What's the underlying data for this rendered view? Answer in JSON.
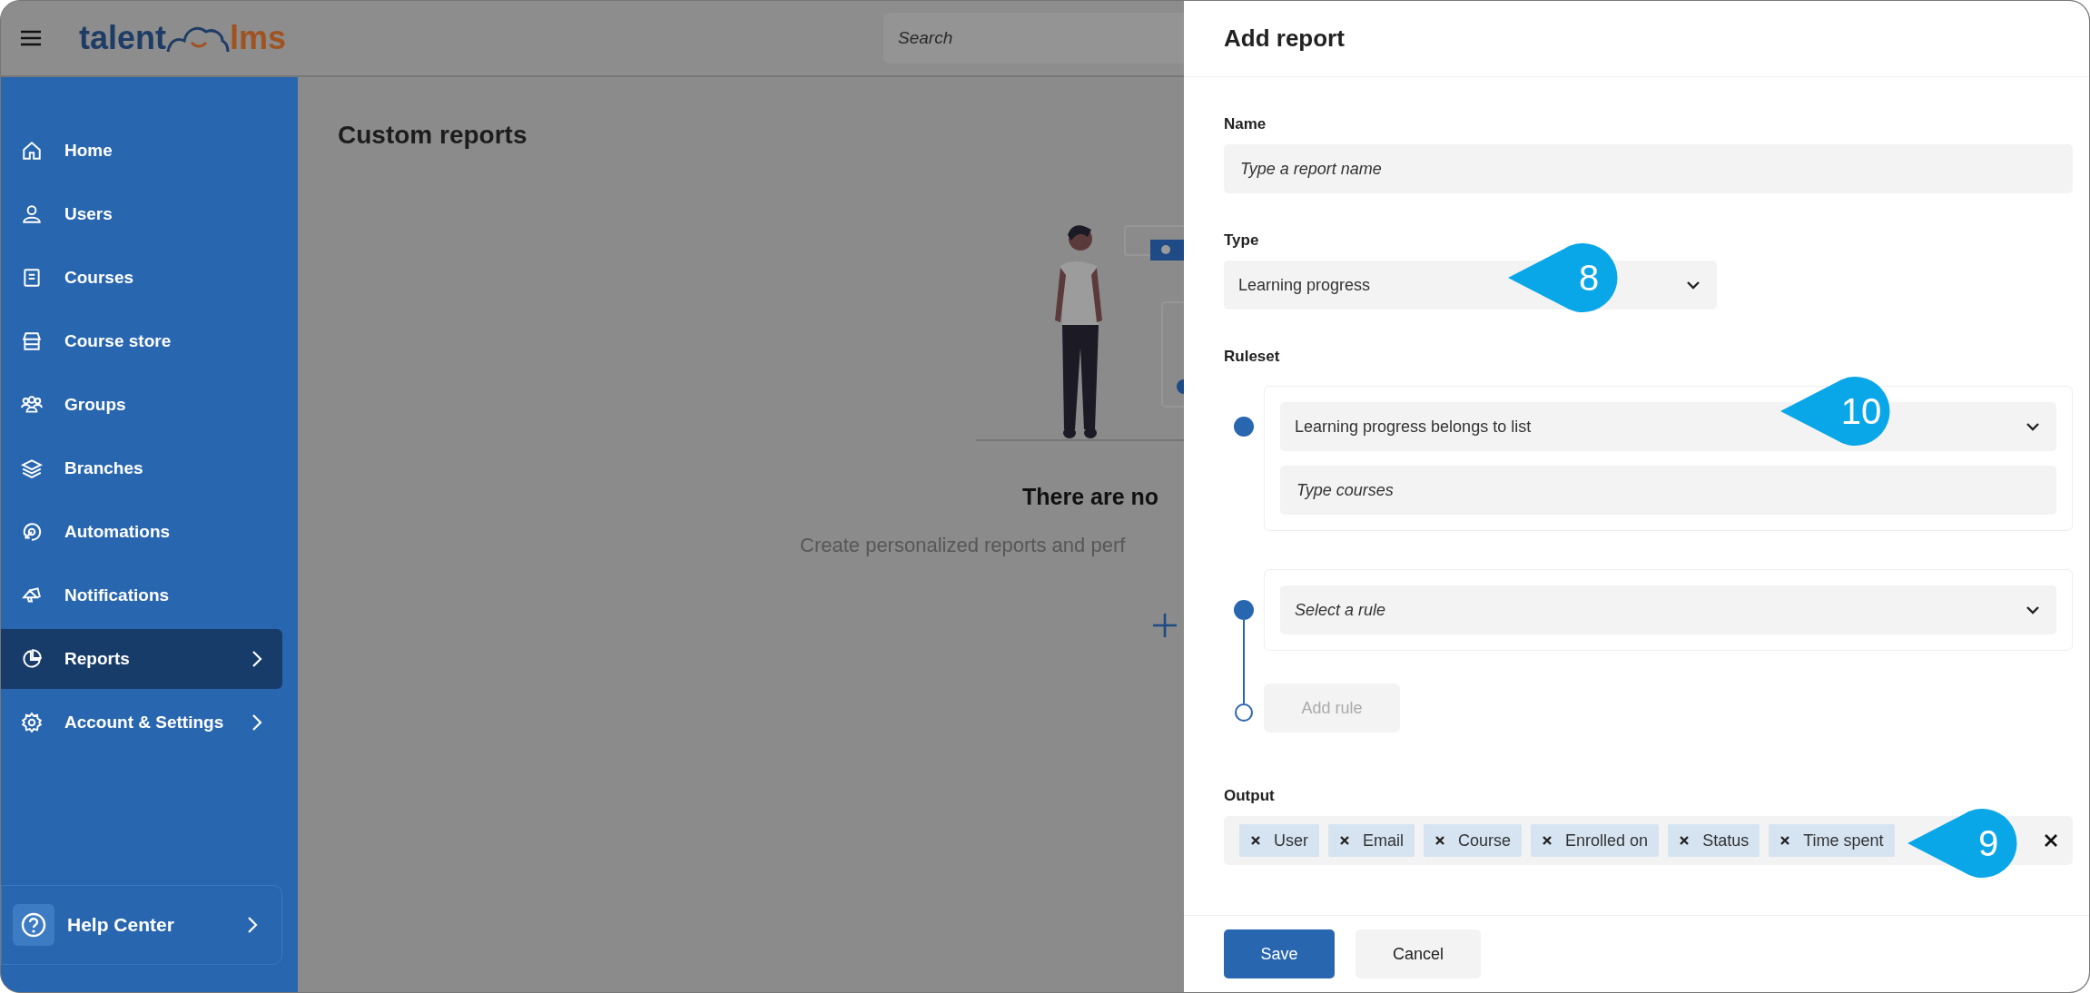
{
  "header": {
    "logo": {
      "left": "talent",
      "right": "lms"
    },
    "search": {
      "placeholder": "Search"
    }
  },
  "sidebar": {
    "items": [
      {
        "label": "Home",
        "selected": false,
        "has_submenu": false
      },
      {
        "label": "Users",
        "selected": false,
        "has_submenu": false
      },
      {
        "label": "Courses",
        "selected": false,
        "has_submenu": false
      },
      {
        "label": "Course store",
        "selected": false,
        "has_submenu": false
      },
      {
        "label": "Groups",
        "selected": false,
        "has_submenu": false
      },
      {
        "label": "Branches",
        "selected": false,
        "has_submenu": false
      },
      {
        "label": "Automations",
        "selected": false,
        "has_submenu": false
      },
      {
        "label": "Notifications",
        "selected": false,
        "has_submenu": false
      },
      {
        "label": "Reports",
        "selected": true,
        "has_submenu": true
      },
      {
        "label": "Account & Settings",
        "selected": false,
        "has_submenu": true
      }
    ],
    "help": {
      "label": "Help Center"
    }
  },
  "main": {
    "title": "Custom reports",
    "empty_state": {
      "heading": "There are no",
      "text": "Create personalized reports and perf"
    }
  },
  "drawer": {
    "title": "Add report",
    "name": {
      "label": "Name",
      "placeholder": "Type a report name"
    },
    "type": {
      "label": "Type",
      "value": "Learning progress"
    },
    "ruleset": {
      "label": "Ruleset",
      "rules": [
        {
          "select": {
            "value": "Learning progress belongs to list"
          },
          "input": {
            "placeholder": "Type courses"
          }
        },
        {
          "select": {
            "placeholder": "Select a rule"
          }
        }
      ],
      "add_rule": {
        "label": "Add rule",
        "disabled": true
      }
    },
    "output": {
      "label": "Output",
      "tags": [
        "User",
        "Email",
        "Course",
        "Enrolled on",
        "Status",
        "Time spent"
      ]
    },
    "buttons": [
      {
        "label": "Save",
        "kind": "primary"
      },
      {
        "label": "Cancel",
        "kind": "secondary"
      }
    ]
  },
  "callouts": [
    {
      "number": "8"
    },
    {
      "number": "10"
    },
    {
      "number": "9"
    }
  ]
}
